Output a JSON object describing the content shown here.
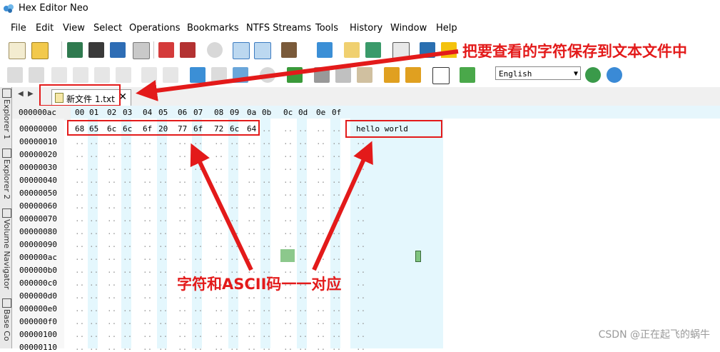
{
  "window": {
    "title": "Hex Editor Neo"
  },
  "menu": [
    "File",
    "Edit",
    "View",
    "Select",
    "Operations",
    "Bookmarks",
    "NTFS Streams",
    "Tools",
    "History",
    "Window",
    "Help"
  ],
  "toolbar": {
    "language": "English"
  },
  "left_panel": [
    "Explorer 1",
    "Explorer 2",
    "Volume Navigator",
    "Base Co"
  ],
  "tab": {
    "name": "新文件 1.txt",
    "close": "✕"
  },
  "hex": {
    "corner": "000000ac",
    "columns": [
      "00",
      "01",
      "02",
      "03",
      "04",
      "05",
      "06",
      "07",
      "08",
      "09",
      "0a",
      "0b",
      "0c",
      "0d",
      "0e",
      "0f"
    ],
    "offsets": [
      "00000000",
      "00000010",
      "00000020",
      "00000030",
      "00000040",
      "00000050",
      "00000060",
      "00000070",
      "00000080",
      "00000090",
      "000000ac",
      "000000b0",
      "000000c0",
      "000000d0",
      "000000e0",
      "000000f0",
      "00000100",
      "00000110"
    ],
    "first_row_bytes": [
      "68",
      "65",
      "6c",
      "6c",
      "6f",
      "20",
      "77",
      "6f",
      "72",
      "6c",
      "64"
    ],
    "ascii_text": "hello world",
    "placeholder": ".."
  },
  "annotations": {
    "save_note": "把要查看的字符保存到文本文件中",
    "mapping_note": "字符和ASCII码一一对应"
  },
  "watermark": "CSDN @正在起飞的蜗牛",
  "colors": {
    "accent_red": "#e31a1a",
    "column_stripe": "#e4f7fd"
  }
}
